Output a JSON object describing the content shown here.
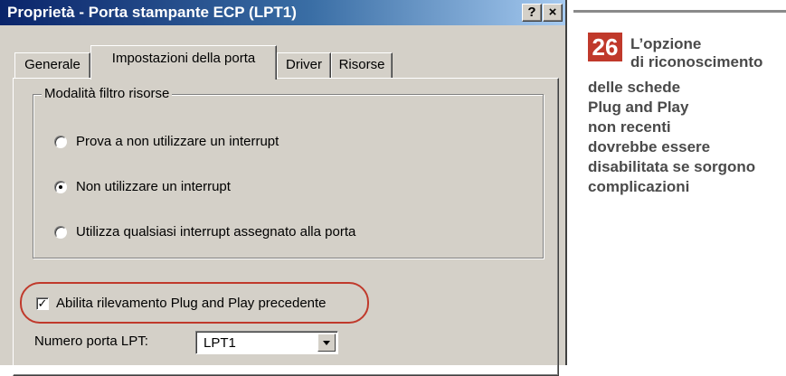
{
  "dialog": {
    "title": "Proprietà - Porta stampante ECP (LPT1)",
    "help_button": "?",
    "close_button": "×",
    "tabs": [
      {
        "label": "Generale",
        "active": false
      },
      {
        "label": "Impostazioni della porta",
        "active": true
      },
      {
        "label": "Driver",
        "active": false
      },
      {
        "label": "Risorse",
        "active": false
      }
    ],
    "group_title": "Modalità filtro risorse",
    "radios": [
      {
        "label": "Prova a non utilizzare un interrupt",
        "selected": false
      },
      {
        "label": "Non utilizzare un interrupt",
        "selected": true
      },
      {
        "label": "Utilizza qualsiasi interrupt assegnato alla porta",
        "selected": false
      }
    ],
    "checkbox": {
      "label": "Abilita rilevamento Plug and Play precedente",
      "checked": true,
      "mark": "✓"
    },
    "lpt": {
      "label": "Numero porta LPT:",
      "value": "LPT1"
    }
  },
  "caption": {
    "number": "26",
    "lines": [
      "L’opzione",
      "di riconoscimento",
      "delle schede",
      "Plug and Play",
      "non recenti",
      "dovrebbe essere",
      "disabilitata se sorgono",
      "complicazioni"
    ]
  },
  "colors": {
    "accent": "#c0392b",
    "title_bar": "#0a246a",
    "dialog_bg": "#d4d0c8"
  }
}
